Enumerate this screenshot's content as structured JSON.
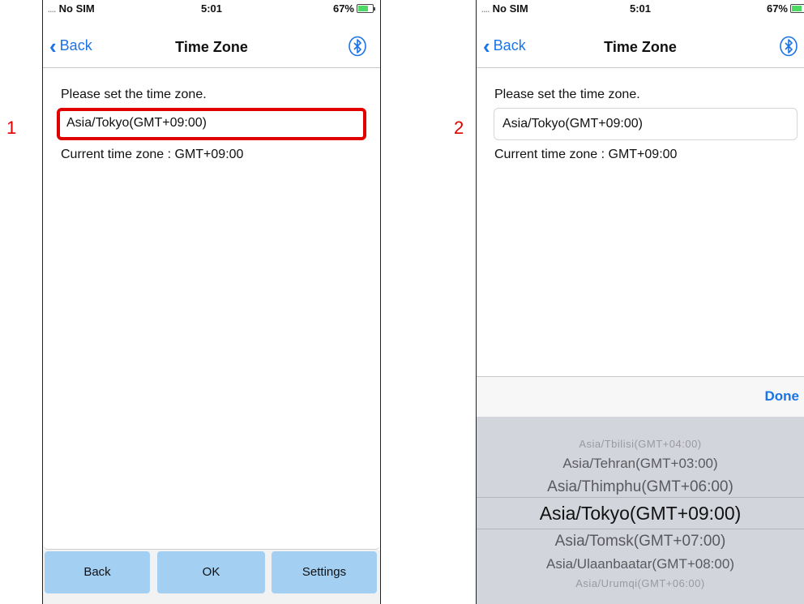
{
  "annotations": {
    "step1": "1",
    "step2": "2"
  },
  "status": {
    "carrier": "No SIM",
    "time": "5:01",
    "battery": "67%"
  },
  "nav": {
    "back_label": "Back",
    "title": "Time Zone"
  },
  "content": {
    "prompt": "Please set the time zone.",
    "selected_zone": "Asia/Tokyo(GMT+09:00)",
    "current_label": "Current time zone : GMT+09:00"
  },
  "bottom_bar": {
    "back": "Back",
    "ok": "OK",
    "settings": "Settings"
  },
  "picker": {
    "done_label": "Done",
    "rows": [
      "Asia/Tbilisi(GMT+04:00)",
      "Asia/Tehran(GMT+03:00)",
      "Asia/Thimphu(GMT+06:00)",
      "Asia/Tokyo(GMT+09:00)",
      "Asia/Tomsk(GMT+07:00)",
      "Asia/Ulaanbaatar(GMT+08:00)",
      "Asia/Urumqi(GMT+06:00)"
    ]
  },
  "colors": {
    "accent": "#1a73e8",
    "highlight": "#e10000",
    "button": "#a3cff3"
  }
}
